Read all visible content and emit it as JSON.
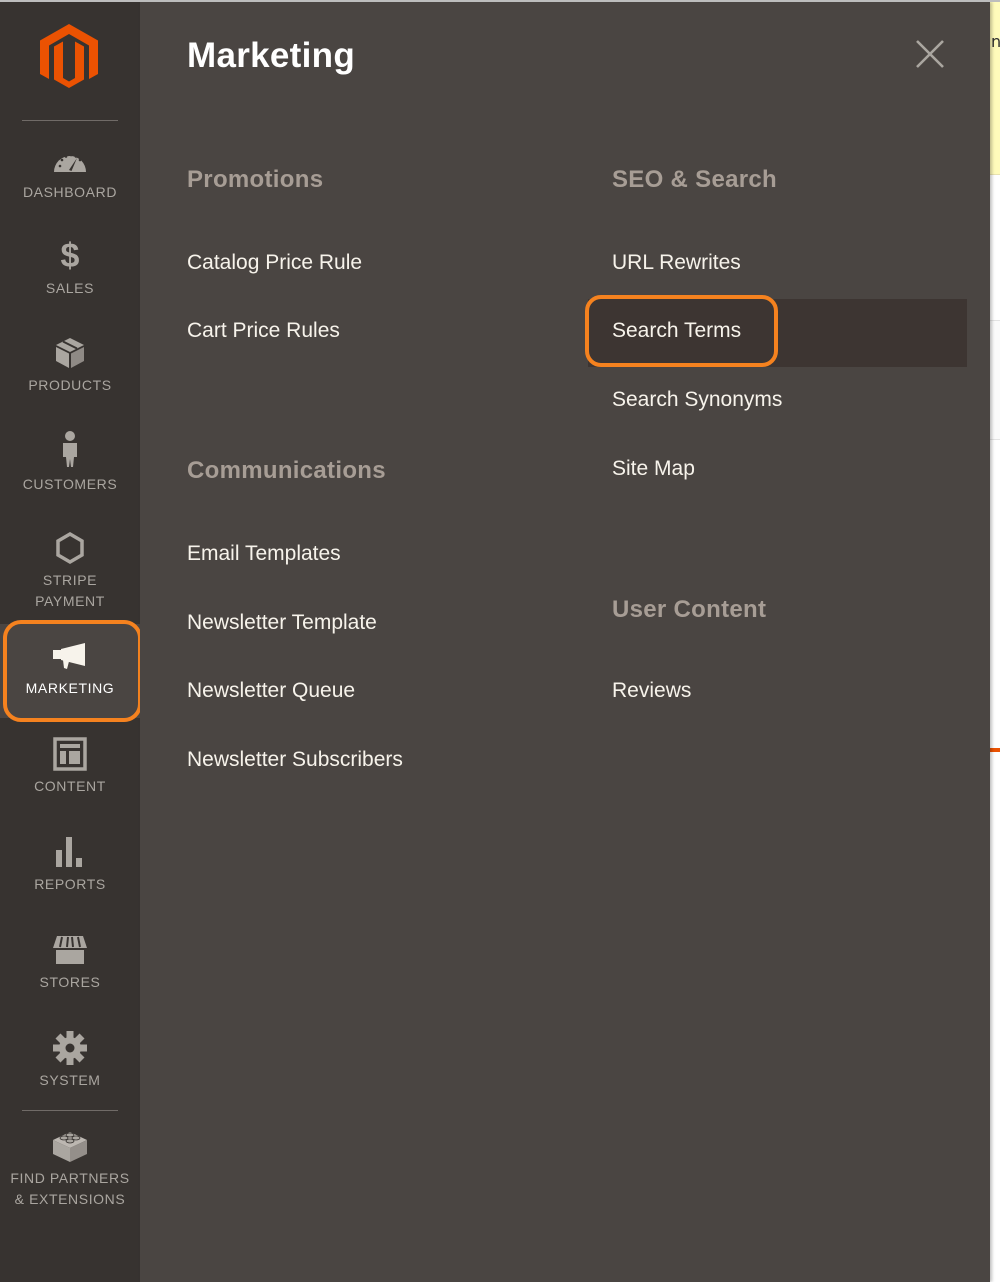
{
  "app": {
    "name": "Magento Admin",
    "brand_color": "#eb5202",
    "highlight_color": "#f5821f"
  },
  "sidebar": {
    "logo": "magento-logo-icon",
    "items": [
      {
        "id": "dashboard",
        "label": "Dashboard",
        "icon": "dashboard-gauge-icon"
      },
      {
        "id": "sales",
        "label": "Sales",
        "icon": "dollar-icon"
      },
      {
        "id": "products",
        "label": "Products",
        "icon": "box-icon"
      },
      {
        "id": "customers",
        "label": "Customers",
        "icon": "person-icon"
      },
      {
        "id": "stripe-payment",
        "label_line1": "Stripe",
        "label_line2": "Payment",
        "icon": "hexagon-icon"
      },
      {
        "id": "marketing",
        "label": "Marketing",
        "icon": "megaphone-icon",
        "active": true
      },
      {
        "id": "content",
        "label": "Content",
        "icon": "layout-icon"
      },
      {
        "id": "reports",
        "label": "Reports",
        "icon": "bar-chart-icon"
      },
      {
        "id": "stores",
        "label": "Stores",
        "icon": "storefront-icon"
      },
      {
        "id": "system",
        "label": "System",
        "icon": "gear-icon"
      },
      {
        "id": "find-partners",
        "label_line1": "Find Partners",
        "label_line2": "& Extensions",
        "icon": "lego-brick-icon"
      }
    ]
  },
  "flyout": {
    "title": "Marketing",
    "close_icon": "close-icon",
    "sections": [
      {
        "title": "Promotions",
        "links": [
          "Catalog Price Rule",
          "Cart Price Rules"
        ]
      },
      {
        "title": "Communications",
        "links": [
          "Email Templates",
          "Newsletter Template",
          "Newsletter Queue",
          "Newsletter Subscribers"
        ]
      },
      {
        "title": "SEO & Search",
        "links": [
          "URL Rewrites",
          "Search Terms",
          "Search Synonyms",
          "Site Map"
        ],
        "highlighted": "Search Terms"
      },
      {
        "title": "User Content",
        "links": [
          "Reviews"
        ]
      }
    ]
  },
  "background_page": {
    "partial_text": "n"
  }
}
